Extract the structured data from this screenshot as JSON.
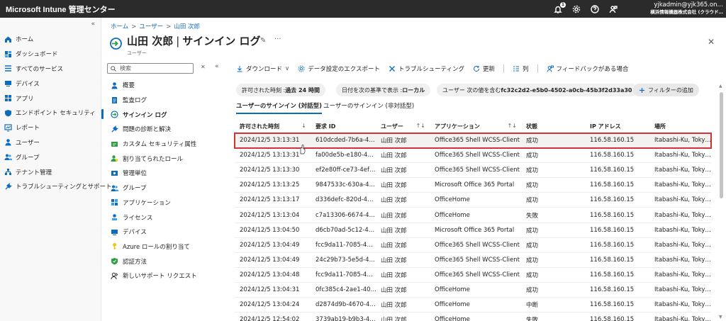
{
  "app": {
    "title": "Microsoft Intune 管理センター",
    "notification_count": "1",
    "account_email": "yjkadmin@yjk365.on…",
    "account_org": "横浜情報機器株式会社 (クラウド…"
  },
  "leftnav": {
    "items": [
      {
        "label": "ホーム",
        "icon": "home-icon"
      },
      {
        "label": "ダッシュボード",
        "icon": "dashboard-icon"
      },
      {
        "label": "すべてのサービス",
        "icon": "list-icon"
      },
      {
        "label": "デバイス",
        "icon": "device-icon"
      },
      {
        "label": "アプリ",
        "icon": "apps-icon"
      },
      {
        "label": "エンドポイント セキュリティ",
        "icon": "shield-icon"
      },
      {
        "label": "レポート",
        "icon": "report-icon"
      },
      {
        "label": "ユーザー",
        "icon": "user-icon"
      },
      {
        "label": "グループ",
        "icon": "group-icon"
      },
      {
        "label": "テナント管理",
        "icon": "tenant-icon"
      },
      {
        "label": "トラブルシューティングとサポート",
        "icon": "wrench-icon"
      }
    ]
  },
  "breadcrumb": {
    "items": [
      "ホーム",
      "ユーザー",
      "山田 次郎"
    ]
  },
  "header": {
    "name": "山田 次郎",
    "title": "サインイン ログ",
    "subtitle": "ユーザー"
  },
  "blade_nav": {
    "search_placeholder": "検索",
    "items": [
      {
        "label": "概要",
        "icon": "user-icon"
      },
      {
        "label": "監査ログ",
        "icon": "audit-icon"
      },
      {
        "label": "サインイン ログ",
        "icon": "signin-icon",
        "active": true
      },
      {
        "label": "問題の診断と解決",
        "icon": "wrench-icon"
      },
      {
        "label": "カスタム セキュリティ属性",
        "icon": "attribute-icon"
      },
      {
        "label": "割り当てられたロール",
        "icon": "role-icon"
      },
      {
        "label": "管理単位",
        "icon": "admin-unit-icon"
      },
      {
        "label": "グループ",
        "icon": "group-icon"
      },
      {
        "label": "アプリケーション",
        "icon": "apps-icon"
      },
      {
        "label": "ライセンス",
        "icon": "license-icon"
      },
      {
        "label": "デバイス",
        "icon": "device-icon"
      },
      {
        "label": "Azure ロールの割り当て",
        "icon": "key-icon"
      },
      {
        "label": "認証方法",
        "icon": "auth-shield-icon"
      },
      {
        "label": "新しいサポート リクエスト",
        "icon": "support-icon"
      }
    ]
  },
  "toolbar": {
    "download": "ダウンロード",
    "export": "データ設定のエクスポート",
    "troubleshoot": "トラブルシューティング",
    "refresh": "更新",
    "columns": "列",
    "feedback": "フィードバックがある場合"
  },
  "filters": {
    "time_label": "許可された時刻 : ",
    "time_value": "過去 24 時間",
    "date_label": "日付を次の基準で表示 : ",
    "date_value": "ローカル",
    "user_label": "ユーザー 次の値を含む ",
    "user_value": "fc32c2d2-e5b0-4502-a0cb-45b3f2d33a30",
    "add_filter": "フィルターの追加"
  },
  "tabs": {
    "interactive": "ユーザーのサインイン (対話型)",
    "noninteractive": "ユーザーのサインイン (非対話型)"
  },
  "table": {
    "columns": [
      "許可された時刻",
      "要求 ID",
      "ユーザー",
      "アプリケーション",
      "状態",
      "IP アドレス",
      "場所"
    ],
    "rows": [
      [
        "2024/12/5 13:13:31",
        "610dcded-7b6a-4…",
        "山田 次郎",
        "Office365 Shell WCSS-Client",
        "成功",
        "116.58.160.15",
        "Itabashi-Ku, Toky…"
      ],
      [
        "2024/12/5 13:13:31",
        "fa00de5b-e180-4…",
        "山田 次郎",
        "Office365 Shell WCSS-Client",
        "成功",
        "116.58.160.15",
        "Itabashi-Ku, Toky…"
      ],
      [
        "2024/12/5 13:13:30",
        "ef2e80ff-ce73-4ef…",
        "山田 次郎",
        "Office365 Shell WCSS-Client",
        "成功",
        "116.58.160.15",
        "Itabashi-Ku, Toky…"
      ],
      [
        "2024/12/5 13:13:25",
        "9847533c-630a-4…",
        "山田 次郎",
        "Microsoft Office 365 Portal",
        "成功",
        "116.58.160.15",
        "Itabashi-Ku, Toky…"
      ],
      [
        "2024/12/5 13:13:17",
        "d336defc-820d-4…",
        "山田 次郎",
        "OfficeHome",
        "成功",
        "116.58.160.15",
        "Itabashi-Ku, Toky…"
      ],
      [
        "2024/12/5 13:13:04",
        "c7a13306-6674-4…",
        "山田 次郎",
        "OfficeHome",
        "失敗",
        "116.58.160.15",
        "Itabashi-Ku, Toky…"
      ],
      [
        "2024/12/5 13:04:50",
        "d6cb70ad-5c12-4…",
        "山田 次郎",
        "Microsoft Office 365 Portal",
        "成功",
        "116.58.160.15",
        "Itabashi-Ku, Toky…"
      ],
      [
        "2024/12/5 13:04:49",
        "fcc9da11-7085-4…",
        "山田 次郎",
        "Office365 Shell WCSS-Client",
        "成功",
        "116.58.160.15",
        "Itabashi-Ku, Toky…"
      ],
      [
        "2024/12/5 13:04:49",
        "24c29b73-5e5d-4…",
        "山田 次郎",
        "Office365 Shell WCSS-Client",
        "成功",
        "116.58.160.15",
        "Itabashi-Ku, Toky…"
      ],
      [
        "2024/12/5 13:04:48",
        "fcc9da11-7085-4…",
        "山田 次郎",
        "Office365 Shell WCSS-Client",
        "成功",
        "116.58.160.15",
        "Itabashi-Ku, Toky…"
      ],
      [
        "2024/12/5 13:04:31",
        "0fc385c4-2ae1-40…",
        "山田 次郎",
        "OfficeHome",
        "成功",
        "116.58.160.15",
        "Itabashi-Ku, Toky…"
      ],
      [
        "2024/12/5 13:04:24",
        "d2874d9b-4670-4…",
        "山田 次郎",
        "OfficeHome",
        "中断",
        "116.58.160.15",
        "Itabashi-Ku, Toky…"
      ],
      [
        "2024/12/5 12:54:02",
        "3739ab19-b9b3-4…",
        "山田 次郎",
        "OfficeHome",
        "失敗",
        "116.58.160.15",
        "Itabashi-Ku, Toky…"
      ]
    ]
  },
  "colors": {
    "topbar": "#2b2b2b",
    "accent": "#0f6cbd",
    "highlight": "#d13438"
  }
}
